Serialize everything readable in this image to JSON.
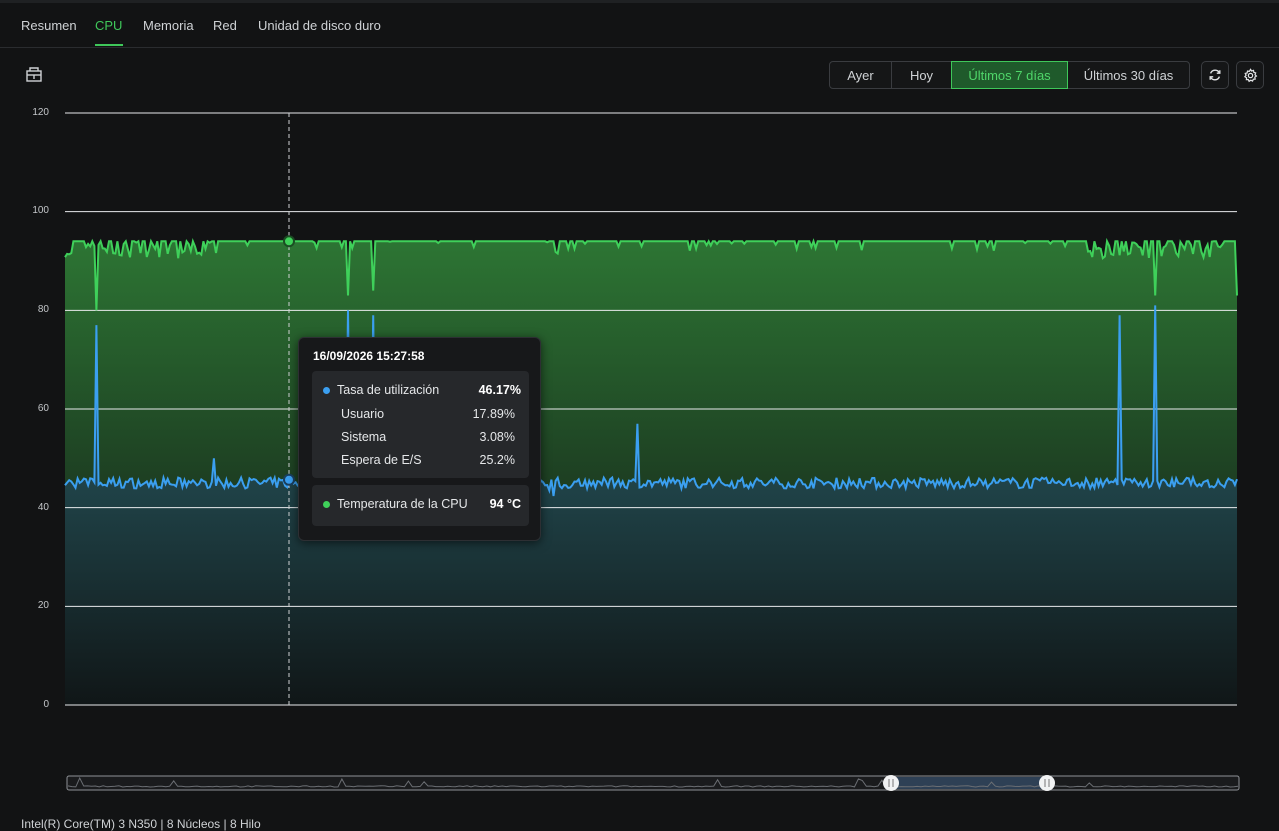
{
  "tabs": [
    {
      "label": "Resumen",
      "active": false
    },
    {
      "label": "CPU",
      "active": true
    },
    {
      "label": "Memoria",
      "active": false
    },
    {
      "label": "Red",
      "active": false
    },
    {
      "label": "Unidad de disco duro",
      "active": false
    }
  ],
  "toolbar": {
    "left_icon": "building-icon",
    "ranges": [
      {
        "label": "Ayer",
        "active": false
      },
      {
        "label": "Hoy",
        "active": false
      },
      {
        "label": "Últimos 7 días",
        "active": true
      },
      {
        "label": "Últimos 30 días",
        "active": false
      }
    ],
    "refresh_icon": "refresh-icon",
    "settings_icon": "gear-icon"
  },
  "colors": {
    "accent": "#3fc75a",
    "temperature": "#3fd05a",
    "utilization": "#3b9ff0",
    "background": "#121314"
  },
  "chart_data": {
    "type": "line",
    "ylim": [
      0,
      120
    ],
    "yticks": [
      "0",
      "20",
      "40",
      "60",
      "80",
      "100",
      "120"
    ],
    "grid": true,
    "series": [
      {
        "name": "Temperatura de la CPU",
        "baseline": 94,
        "unit": "°C",
        "dips": [
          {
            "x": 0.027,
            "y": 80
          },
          {
            "x": 0.241,
            "y": 83
          },
          {
            "x": 0.263,
            "y": 84
          },
          {
            "x": 0.93,
            "y": 83
          },
          {
            "x": 1.0,
            "y": 83
          }
        ]
      },
      {
        "name": "Tasa de utilización",
        "baseline": 45,
        "unit": "%",
        "spikes": [
          {
            "x": 0.027,
            "y": 77
          },
          {
            "x": 0.127,
            "y": 50
          },
          {
            "x": 0.241,
            "y": 80
          },
          {
            "x": 0.263,
            "y": 79
          },
          {
            "x": 0.488,
            "y": 57
          },
          {
            "x": 0.93,
            "y": 81
          },
          {
            "x": 0.9,
            "y": 79
          }
        ]
      }
    ]
  },
  "tooltip": {
    "timestamp": "16/09/2026 15:27:58",
    "utilization": {
      "label": "Tasa de utilización",
      "value": "46.17%"
    },
    "details": [
      {
        "label": "Usuario",
        "value": "17.89%"
      },
      {
        "label": "Sistema",
        "value": "3.08%"
      },
      {
        "label": "Espera de E/S",
        "value": "25.2%"
      }
    ],
    "temperature": {
      "label": "Temperatura de la CPU",
      "value": "94 °C"
    }
  },
  "footer": {
    "text": "Intel(R) Core(TM) 3 N350 | 8 Núcleos | 8 Hilo"
  }
}
